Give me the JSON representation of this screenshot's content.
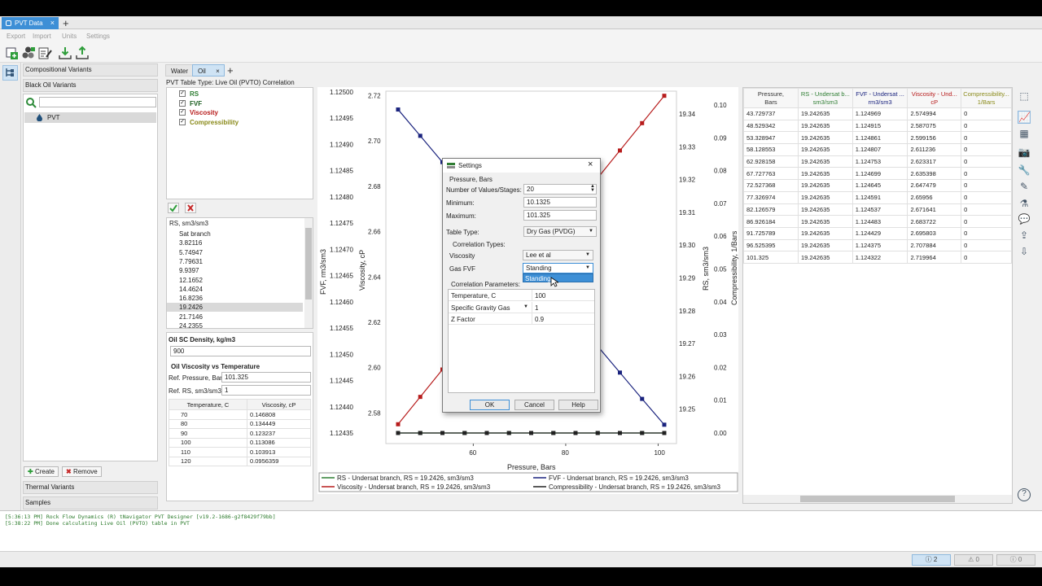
{
  "doc_tab": {
    "label": "PVT Data",
    "close": "×"
  },
  "menu": [
    "Export",
    "Import",
    "Units",
    "Settings"
  ],
  "sidebar": {
    "sections": [
      "Compositional Variants",
      "Black Oil Variants",
      "Thermal Variants",
      "Samples"
    ],
    "tree_item": "PVT",
    "create_label": "Create",
    "remove_label": "Remove"
  },
  "subtabs": {
    "water": "Water",
    "oil": "Oil",
    "oil_close": "×",
    "add": "+"
  },
  "table_type_label": "PVT Table Type: Live Oil (PVTO) Correlation",
  "series_checks": [
    {
      "label": "RS",
      "color": "#2e7d32"
    },
    {
      "label": "FVF",
      "color": "#1b5e20"
    },
    {
      "label": "Viscosity",
      "color": "#b71c1c"
    },
    {
      "label": "Compressibility",
      "color": "#8a8a1a"
    }
  ],
  "rs_list": {
    "header": "RS, sm3/sm3",
    "items": [
      "Sat branch",
      "3.82116",
      "5.74947",
      "7.79631",
      "9.9397",
      "12.1652",
      "14.4624",
      "16.8236",
      "19.2426",
      "21.7146",
      "24.2355"
    ],
    "selected": "19.2426"
  },
  "oil_sc": {
    "label": "Oil SC Density, kg/m3",
    "value": "900"
  },
  "visc_vs_temp": {
    "title": "Oil Viscosity vs Temperature",
    "ref_pressure_label": "Ref. Pressure, Bars",
    "ref_pressure": "101.325",
    "ref_rs_label": "Ref. RS, sm3/sm3",
    "ref_rs": "1",
    "headers": [
      "Temperature, C",
      "Viscosity, cP"
    ],
    "rows": [
      [
        "70",
        "0.146808"
      ],
      [
        "80",
        "0.134449"
      ],
      [
        "90",
        "0.123237"
      ],
      [
        "100",
        "0.113086"
      ],
      [
        "110",
        "0.103913"
      ],
      [
        "120",
        "0.0956359"
      ]
    ]
  },
  "chart_data": {
    "type": "line",
    "xlabel": "Pressure, Bars",
    "xticks": [
      "60",
      "80",
      "100"
    ],
    "xlim": [
      43.73,
      101.325
    ],
    "axes": {
      "fvf": {
        "label": "FVF, rm3/sm3",
        "ticks": [
          "1.12500",
          "1.12495",
          "1.12490",
          "1.12485",
          "1.12480",
          "1.12475",
          "1.12470",
          "1.12465",
          "1.12460",
          "1.12455",
          "1.12450",
          "1.12445",
          "1.12440",
          "1.12435"
        ],
        "ylim": [
          1.1243,
          1.125
        ]
      },
      "viscosity": {
        "label": "Viscosity, cP",
        "ticks": [
          "2.72",
          "2.70",
          "2.68",
          "2.66",
          "2.64",
          "2.62",
          "2.60",
          "2.58"
        ],
        "ylim": [
          2.5715,
          2.722
        ]
      },
      "rs": {
        "label": "RS, sm3/sm3",
        "ticks": [
          "19.34",
          "19.33",
          "19.32",
          "19.31",
          "19.30",
          "19.29",
          "19.28",
          "19.27",
          "19.26",
          "19.25"
        ]
      },
      "compressibility": {
        "label": "Compressibility, 1/Bars",
        "ticks": [
          "0.10",
          "0.09",
          "0.08",
          "0.07",
          "0.06",
          "0.05",
          "0.04",
          "0.03",
          "0.02",
          "0.01",
          "0.00"
        ],
        "ylim": [
          0,
          0.1
        ]
      }
    },
    "x": [
      43.729737,
      48.529342,
      53.328947,
      58.128553,
      62.928158,
      67.727763,
      72.527368,
      77.326974,
      82.126579,
      86.926184,
      91.725789,
      96.525395,
      101.325
    ],
    "series": [
      {
        "name": "RS - Undersat branch, RS = 19.2426, sm3/sm3",
        "color": "#2e7d32",
        "axis": "compressibility",
        "values": [
          0,
          0,
          0,
          0,
          0,
          0,
          0,
          0,
          0,
          0,
          0,
          0,
          0
        ]
      },
      {
        "name": "FVF - Undersat branch, RS = 19.2426, sm3/sm3",
        "color": "#1a237e",
        "axis": "fvf",
        "values": [
          1.124969,
          1.124915,
          1.124861,
          1.124807,
          1.124753,
          1.124699,
          1.124645,
          1.124591,
          1.124537,
          1.124483,
          1.124429,
          1.124375,
          1.124322
        ]
      },
      {
        "name": "Viscosity - Undersat branch, RS = 19.2426, sm3/sm3",
        "color": "#b71c1c",
        "axis": "viscosity",
        "values": [
          2.574994,
          2.587075,
          2.599156,
          2.611236,
          2.623317,
          2.635398,
          2.647479,
          2.65956,
          2.671641,
          2.683722,
          2.695803,
          2.707884,
          2.719964
        ]
      },
      {
        "name": "Compressibility - Undersat branch, RS = 19.2426, sm3/sm3",
        "color": "#222222",
        "axis": "compressibility",
        "values": [
          0,
          0,
          0,
          0,
          0,
          0,
          0,
          0,
          0,
          0,
          0,
          0,
          0
        ]
      }
    ]
  },
  "data_table": {
    "headers": [
      "Pressure,\nBars",
      "RS - Undersat b...\nsm3/sm3",
      "FVF - Undersat ...\nrm3/sm3",
      "Viscosity - Und...\ncP",
      "Compressibility...\n1/Bars"
    ],
    "rows": [
      [
        "43.729737",
        "19.242635",
        "1.124969",
        "2.574994",
        "0"
      ],
      [
        "48.529342",
        "19.242635",
        "1.124915",
        "2.587075",
        "0"
      ],
      [
        "53.328947",
        "19.242635",
        "1.124861",
        "2.599156",
        "0"
      ],
      [
        "58.128553",
        "19.242635",
        "1.124807",
        "2.611236",
        "0"
      ],
      [
        "62.928158",
        "19.242635",
        "1.124753",
        "2.623317",
        "0"
      ],
      [
        "67.727763",
        "19.242635",
        "1.124699",
        "2.635398",
        "0"
      ],
      [
        "72.527368",
        "19.242635",
        "1.124645",
        "2.647479",
        "0"
      ],
      [
        "77.326974",
        "19.242635",
        "1.124591",
        "2.65956",
        "0"
      ],
      [
        "82.126579",
        "19.242635",
        "1.124537",
        "2.671641",
        "0"
      ],
      [
        "86.926184",
        "19.242635",
        "1.124483",
        "2.683722",
        "0"
      ],
      [
        "91.725789",
        "19.242635",
        "1.124429",
        "2.695803",
        "0"
      ],
      [
        "96.525395",
        "19.242635",
        "1.124375",
        "2.707884",
        "0"
      ],
      [
        "101.325",
        "19.242635",
        "1.124322",
        "2.719964",
        "0"
      ]
    ]
  },
  "dialog": {
    "title": "Settings",
    "close": "×",
    "section": "Pressure, Bars",
    "num_label": "Number of Values/Stages:",
    "num_value": "20",
    "min_label": "Minimum:",
    "min_value": "10.1325",
    "max_label": "Maximum:",
    "max_value": "101.325",
    "table_type_label": "Table Type:",
    "table_type_value": "Dry Gas (PVDG)",
    "corr_types_label": "Correlation Types:",
    "visc_label": "Viscosity",
    "visc_value": "Lee et al",
    "gasfvf_label": "Gas FVF",
    "gasfvf_value": "Standing",
    "dropdown_option": "Standing",
    "corr_params_label": "Correlation Parameters:",
    "params": [
      [
        "Temperature, C",
        "100"
      ],
      [
        "Specific Gravity Gas",
        "1"
      ],
      [
        "Z Factor",
        "0.9"
      ]
    ],
    "ok": "OK",
    "cancel": "Cancel",
    "help": "Help"
  },
  "log": [
    "[5:36:13 PM] Rock Flow Dynamics (R) tNavigator PVT Designer [v19.2-1686-g2f8429f79bb]",
    "[5:38:22 PM] Done calculating Live Oil (PVTO) table in PVT"
  ],
  "status": {
    "info": "2",
    "warn": "0",
    "err": "0"
  }
}
